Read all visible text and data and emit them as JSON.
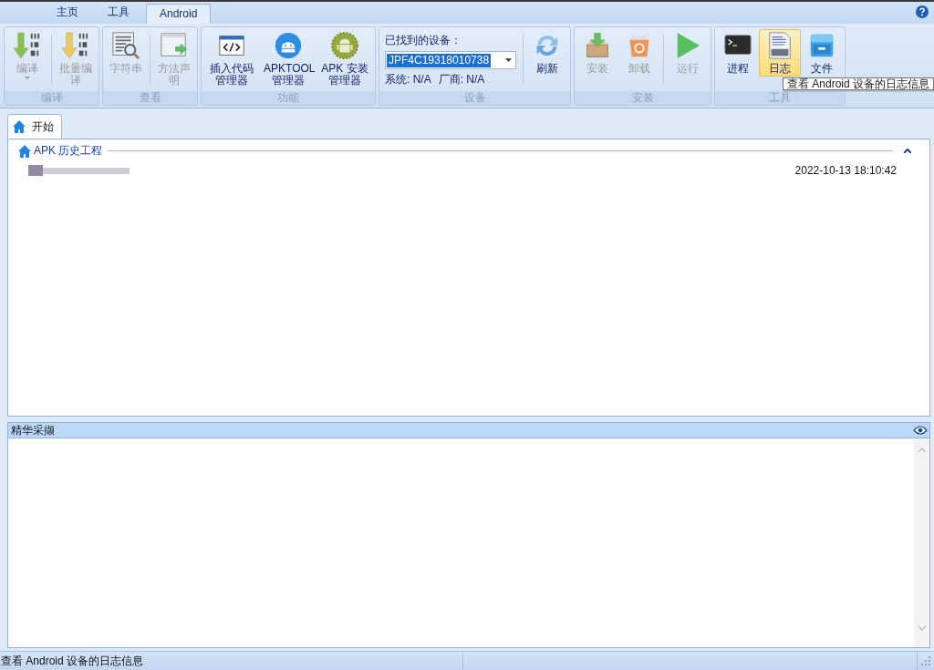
{
  "tabs": [
    {
      "label": "主页",
      "selected": false
    },
    {
      "label": "工具",
      "selected": false
    },
    {
      "label": "Android",
      "selected": true
    }
  ],
  "ribbon_groups": [
    {
      "title": "编译",
      "kind": "buttons",
      "items": [
        {
          "label": "编译",
          "disabled": true,
          "dropdown": true,
          "highlighted": false
        },
        {
          "label": "批量编译",
          "disabled": true,
          "highlighted": false
        }
      ]
    },
    {
      "title": "查看",
      "kind": "buttons",
      "items": [
        {
          "label": "字符串",
          "disabled": true,
          "highlighted": false
        },
        {
          "label": "方法声明",
          "disabled": true,
          "highlighted": false
        }
      ]
    },
    {
      "title": "功能",
      "kind": "buttons",
      "items": [
        {
          "label": "插入代码管理器",
          "disabled": false,
          "highlighted": false
        },
        {
          "label": "APKTOOL 管理器",
          "disabled": false,
          "highlighted": false
        },
        {
          "label": "APK 安装管理器",
          "disabled": false,
          "highlighted": false
        }
      ]
    },
    {
      "title": "设备",
      "kind": "device",
      "caption": "已找到的设备：",
      "device": "JPF4C19318010738",
      "system": "系统: N/A",
      "vendor": "厂商: N/A",
      "refresh": {
        "label": "刷新",
        "disabled": false
      }
    },
    {
      "title": "安装",
      "kind": "buttons",
      "items": [
        {
          "label": "安装",
          "disabled": true,
          "highlighted": false
        },
        {
          "label": "卸载",
          "disabled": true,
          "highlighted": false
        },
        {
          "label": "运行",
          "disabled": true,
          "highlighted": false
        }
      ]
    },
    {
      "title": "工具",
      "kind": "buttons",
      "items": [
        {
          "label": "进程",
          "disabled": false,
          "highlighted": false
        },
        {
          "label": "日志",
          "disabled": false,
          "highlighted": true
        },
        {
          "label": "文件",
          "disabled": false,
          "highlighted": false
        }
      ]
    }
  ],
  "tooltip": "查看 Android 设备的日志信息",
  "doc_tabs": [
    {
      "label": "开始",
      "selected": true
    }
  ],
  "history": {
    "title": "APK 历史工程",
    "expanded": true,
    "entries": [
      {
        "date": "2022-10-13 18:10:42"
      }
    ]
  },
  "bottom_panel": {
    "title": "精华采撷"
  },
  "status_bar": "查看 Android 设备的日志信息"
}
